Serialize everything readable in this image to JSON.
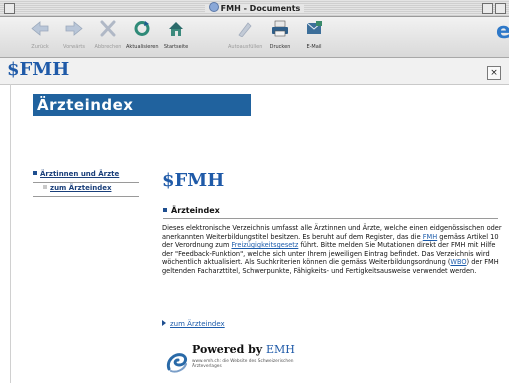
{
  "window": {
    "title": "FMH - Documents"
  },
  "toolbar": {
    "buttons": [
      {
        "label": "Zurück",
        "icon": "back-arrow-icon",
        "enabled": false
      },
      {
        "label": "Vorwärts",
        "icon": "forward-arrow-icon",
        "enabled": false
      },
      {
        "label": "Abbrechen",
        "icon": "stop-icon",
        "enabled": false
      },
      {
        "label": "Aktualisieren",
        "icon": "refresh-icon",
        "enabled": true
      },
      {
        "label": "Startseite",
        "icon": "home-icon",
        "enabled": true
      },
      {
        "label": "Autoausfüllen",
        "icon": "autofill-icon",
        "enabled": false
      },
      {
        "label": "Drucken",
        "icon": "printer-icon",
        "enabled": true
      },
      {
        "label": "E-Mail",
        "icon": "mail-icon",
        "enabled": true
      }
    ],
    "browser_logo": "e"
  },
  "header": {
    "logo_symbol": "$",
    "logo_text": "FMH",
    "close_label": "×"
  },
  "page": {
    "heading": "Ärzteindex",
    "nav": {
      "item": "Ärztinnen und Ärzte",
      "subitem": "zum Ärzteindex"
    },
    "content_logo_symbol": "$",
    "content_logo_text": "FMH",
    "section_title": "Ärzteindex",
    "body": {
      "p1": "Dieses elektronische Verzeichnis umfasst alle Ärztinnen und Ärzte, welche einen eidgenössischen oder anerkannten Weiterbildungstitel besitzen. Es beruht auf dem Register, das die ",
      "link_fmh": "FMH",
      "p2": " gemäss Artikel 10 der Verordnung zum ",
      "link_fzg": "Freizügigkeitsgesetz",
      "p3": " führt. Bitte melden Sie Mutationen direkt der FMH mit Hilfe der \"Feedback-Funktion\", welche sich unter Ihrem jeweiligen Eintrag befindet. Das Verzeichnis wird wöchentlich aktualisiert. Als Suchkriterien können die gemäss Weiterbildungsordnung (",
      "link_wbo": "WBO",
      "p4": ") der FMH geltenden Facharzttitel, Schwerpunkte, Fähigkeits- und Fertigkeitsausweise verwendet werden."
    },
    "arrow_link": "zum Ärzteindex",
    "powered": {
      "text": "Powered by ",
      "brand": "EMH",
      "sub": "www.emh.ch: die Website des Schweizerischen Ärzteverlages"
    }
  },
  "colors": {
    "brand_blue": "#1f5aa8",
    "heading_bar": "#20629e",
    "link": "#1d5cab"
  }
}
